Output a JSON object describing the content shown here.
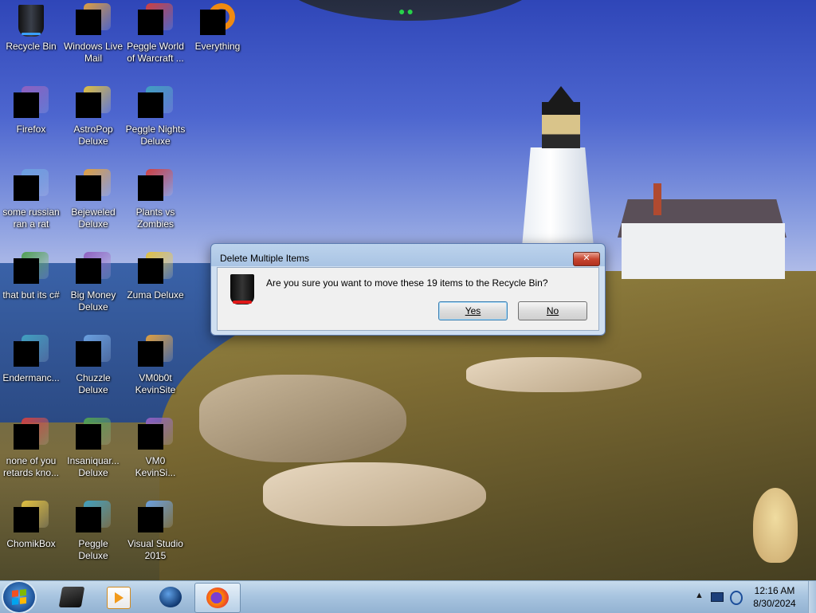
{
  "desktop": {
    "icons": [
      {
        "label": "Recycle Bin",
        "icon": "recycle-bin-icon"
      },
      {
        "label": "Windows Live Mail",
        "icon": "mail-icon"
      },
      {
        "label": "Peggle World of Warcraft ...",
        "icon": "game-icon"
      },
      {
        "label": "Everything",
        "icon": "search-app-icon"
      },
      {
        "label": "Firefox",
        "icon": "firefox-icon"
      },
      {
        "label": "AstroPop Deluxe",
        "icon": "game-icon"
      },
      {
        "label": "Peggle Nights Deluxe",
        "icon": "game-icon"
      },
      {
        "label": "some russian ran a rat",
        "icon": "file-icon"
      },
      {
        "label": "Bejeweled Deluxe",
        "icon": "game-icon"
      },
      {
        "label": "Plants vs Zombies",
        "icon": "game-icon"
      },
      {
        "label": "that but its c#",
        "icon": "file-icon"
      },
      {
        "label": "Big Money Deluxe",
        "icon": "game-icon"
      },
      {
        "label": "Zuma Deluxe",
        "icon": "game-icon"
      },
      {
        "label": "Endermanc...",
        "icon": "terminal-icon"
      },
      {
        "label": "Chuzzle Deluxe",
        "icon": "game-icon"
      },
      {
        "label": "VM0b0t KevinSite",
        "icon": "terminal-icon"
      },
      {
        "label": "none of you retards kno...",
        "icon": "file-icon"
      },
      {
        "label": "Insaniquar... Deluxe",
        "icon": "game-icon"
      },
      {
        "label": "VM0 KevinSi...",
        "icon": "file-icon"
      },
      {
        "label": "ChomikBox",
        "icon": "app-icon"
      },
      {
        "label": "Peggle Deluxe",
        "icon": "game-icon"
      },
      {
        "label": "Visual Studio 2015",
        "icon": "visual-studio-icon"
      }
    ]
  },
  "dialog": {
    "title": "Delete Multiple Items",
    "close_label": "✕",
    "message": "Are you sure you want to move these 19 items to the Recycle Bin?",
    "yes_label": "Yes",
    "no_label": "No"
  },
  "taskbar": {
    "pinned": [
      {
        "name": "explorer-icon"
      },
      {
        "name": "media-player-icon"
      },
      {
        "name": "globe-icon"
      },
      {
        "name": "firefox-icon",
        "active": true
      }
    ],
    "tray": {
      "show_hidden": "▲"
    },
    "clock": {
      "time": "12:16 AM",
      "date": "8/30/2024"
    }
  },
  "colors": {
    "taskbar": "#a9c5e0",
    "dialog_title": "#bcd3ec",
    "close": "#c74530"
  }
}
